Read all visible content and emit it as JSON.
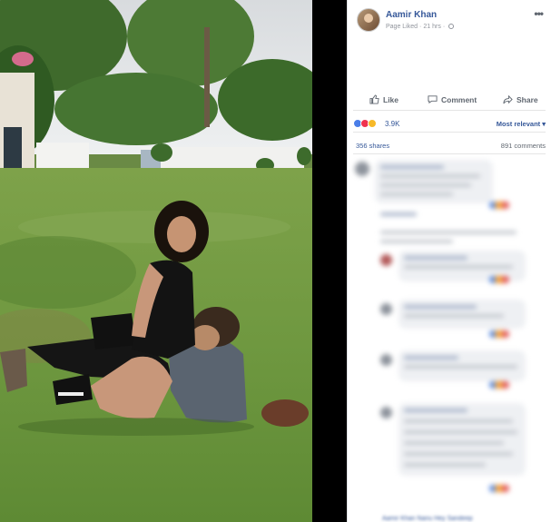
{
  "post": {
    "author": "Aamir Khan",
    "meta_label": "Page Liked",
    "time": "21 hrs",
    "menu_label": "•••"
  },
  "actions": {
    "like_label": "Like",
    "comment_label": "Comment",
    "share_label": "Share"
  },
  "reactions": {
    "count": "3.9K",
    "sort_label": "Most relevant ▾"
  },
  "stats": {
    "shares": "356 shares",
    "comments": "891 comments"
  },
  "footer_hint": "Aamir Khan Nanu Hey Sandeep",
  "colors": {
    "link_blue": "#365899",
    "meta_grey": "#90949c",
    "text_grey": "#606770",
    "divider": "#000000"
  },
  "icons": [
    "like-icon",
    "comment-icon",
    "share-icon",
    "globe-icon",
    "menu-dots-icon",
    "like-reaction-icon",
    "love-reaction-icon",
    "haha-reaction-icon"
  ]
}
